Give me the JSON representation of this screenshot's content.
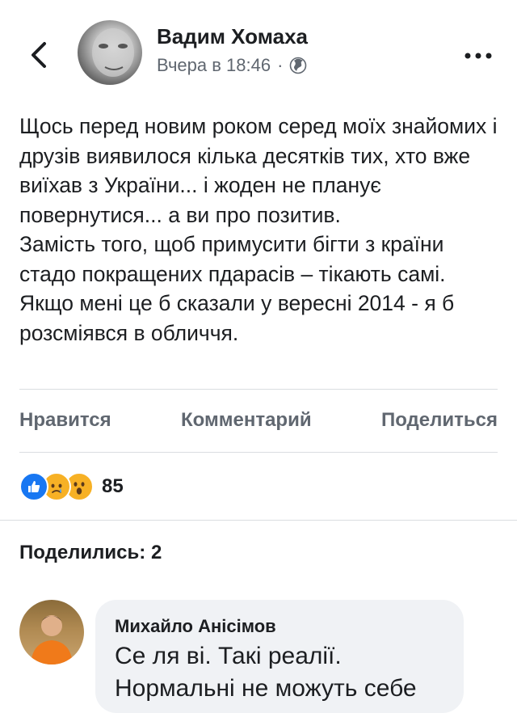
{
  "post": {
    "author": "Вадим Хомаха",
    "timestamp": "Вчера в 18:46",
    "separator": "·",
    "privacy_icon": "globe-icon",
    "paragraph1": "Щось перед новим роком серед моїх знайомих і друзів виявилося кілька десятків тих, хто вже виїхав з України... і жоден не планує повернутися... а ви про позитив.",
    "paragraph2": "Замість того, щоб примусити бігти з країни стадо покращених пдарасів – тікають самі.",
    "paragraph3": "Якщо мені це б сказали у вересні 2014 - я б розсміявся в обличчя."
  },
  "actions": {
    "like": "Нравится",
    "comment": "Комментарий",
    "share": "Поделиться"
  },
  "reactions": {
    "icons": [
      "like-icon",
      "sad-icon",
      "wow-icon"
    ],
    "count": "85"
  },
  "shares": {
    "label": "Поделились: 2"
  },
  "comment": {
    "author": "Михайло Анісімов",
    "text": "Се ля ві. Такі реалії. Нормальні не можуть себе"
  },
  "colors": {
    "like_blue": "#1877f2",
    "reaction_yellow": "#f7b125",
    "secondary_text": "#606770",
    "bubble_bg": "#f0f2f5"
  }
}
